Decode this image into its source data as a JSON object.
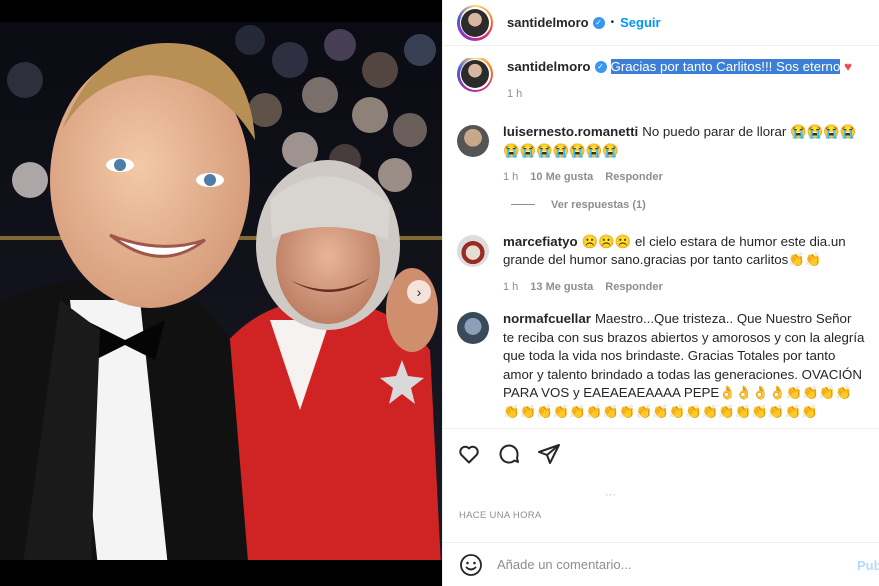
{
  "post": {
    "username": "santidelmoro",
    "follow_label": "Seguir",
    "dot": "•",
    "caption_text": "Gracias por tanto Carlitos!!! Sos eterno",
    "caption_time": "1 h",
    "heart": "♥"
  },
  "comments": [
    {
      "username": "luisernesto.romanetti",
      "text": "No puedo parar de llorar 😭😭😭😭 😭😭😭😭😭😭😭",
      "time": "1 h",
      "likes": "10 Me gusta",
      "reply_label": "Responder",
      "view_replies": "Ver respuestas (1)"
    },
    {
      "username": "marcefiatyo",
      "text": "☹️☹️☹️ el cielo estara de humor este dia.un grande del humor sano.gracias por tanto carlitos👏👏",
      "time": "1 h",
      "likes": "13 Me gusta",
      "reply_label": "Responder"
    },
    {
      "username": "normafcuellar",
      "text": "Maestro...Que tristeza.. Que Nuestro Señor te reciba con sus brazos abiertos y amorosos y con la alegría que toda la vida nos brindaste. Gracias Totales por tanto amor y talento brindado a todas las generaciones. OVACIÓN PARA VOS y EAEAEAEAAAA PEPE👌👌👌👌👏👏👏👏👏👏👏👏👏👏👏👏👏👏👏👏👏👏👏👏👏👏👏"
    }
  ],
  "footer": {
    "time_ago": "HACE UNA HORA",
    "comment_placeholder": "Añade un comentario...",
    "publish_label": "Publicar"
  },
  "colors": {
    "accent": "#0095f6",
    "highlight": "#3d7fd6",
    "muted": "#8e8e8e"
  }
}
